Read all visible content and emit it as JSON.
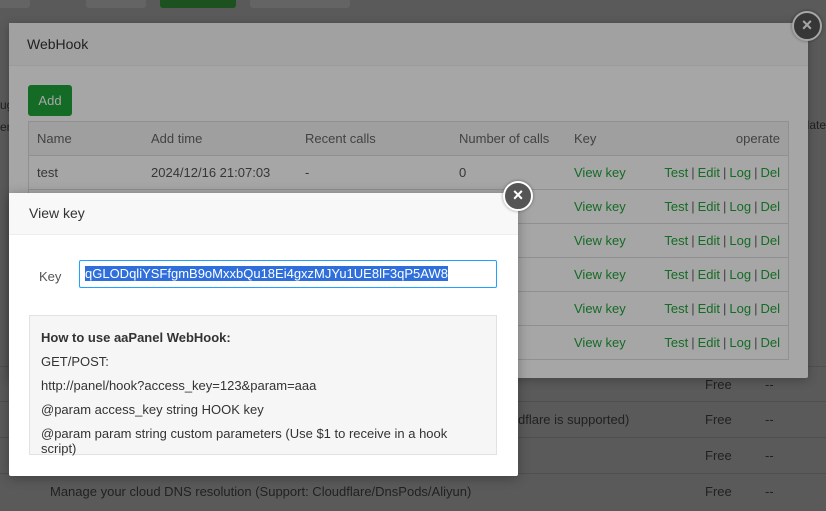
{
  "background": {
    "rows": [
      {
        "desc": "",
        "price": "Free",
        "extra": "--"
      },
      {
        "desc": "dflare is supported)",
        "price": "Free",
        "extra": "--"
      },
      {
        "desc": "",
        "price": "Free",
        "extra": "--"
      },
      {
        "desc": "Manage your cloud DNS resolution (Support: Cloudflare/DnsPods/Aliyun)",
        "price": "Free",
        "extra": "--"
      }
    ],
    "left_edge_text": "ug",
    "left_edge_text2": "er",
    "right_edge_text": "date"
  },
  "webhook": {
    "title": "WebHook",
    "add_label": "Add",
    "columns": [
      "Name",
      "Add time",
      "Recent calls",
      "Number of calls",
      "Key",
      "operate"
    ],
    "rows": [
      {
        "name": "test",
        "add_time": "2024/12/16 21:07:03",
        "recent": "-",
        "count": "0",
        "key": "View key"
      },
      {
        "name": "",
        "add_time": "",
        "recent": "",
        "count": "",
        "key": "View key"
      },
      {
        "name": "",
        "add_time": "",
        "recent": "",
        "count": "",
        "key": "View key"
      },
      {
        "name": "",
        "add_time": "",
        "recent": "",
        "count": "",
        "key": "View key"
      },
      {
        "name": "",
        "add_time": "",
        "recent": "",
        "count": "",
        "key": "View key"
      },
      {
        "name": "",
        "add_time": "",
        "recent": "",
        "count": "",
        "key": "View key"
      }
    ],
    "ops": {
      "test": "Test",
      "edit": "Edit",
      "log": "Log",
      "del": "Del",
      "sep": "|"
    },
    "close_glyph": "×"
  },
  "view_key": {
    "title": "View key",
    "key_label": "Key",
    "key_value": "qGLODqliYSFfgmB9oMxxbQu18Ei4gxzMJYu1UE8lF3qP5AW8",
    "help": {
      "title": "How to use aaPanel WebHook:",
      "line1": "GET/POST:",
      "line2": "http://panel/hook?access_key=123&param=aaa",
      "line3": "@param access_key string HOOK key",
      "line4": "@param param string custom parameters (Use $1 to receive in a hook script)"
    },
    "close_glyph": "×"
  },
  "colors": {
    "accent": "#20a53a",
    "selection": "#2f6fdb"
  }
}
